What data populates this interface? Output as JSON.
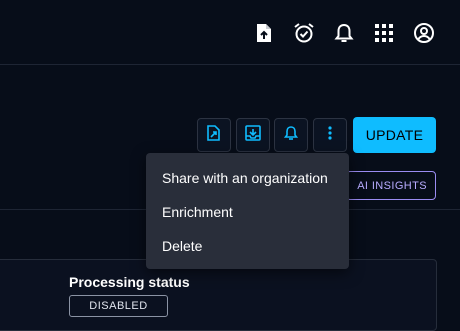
{
  "topbar": {
    "icons": [
      "file-upload-icon",
      "alarm-check-icon",
      "bell-icon",
      "apps-grid-icon",
      "account-circle-icon"
    ]
  },
  "actions": {
    "icons": [
      "file-export-icon",
      "download-icon",
      "bell-icon",
      "more-vertical-icon"
    ],
    "update_label": "UPDATE",
    "ai_label": "AI INSIGHTS",
    "accent_color": "#0fbcff"
  },
  "menu": {
    "items": [
      {
        "label": "Share with an organization"
      },
      {
        "label": "Enrichment"
      },
      {
        "label": "Delete"
      }
    ]
  },
  "card": {
    "label": "Processing status",
    "status": "DISABLED"
  }
}
